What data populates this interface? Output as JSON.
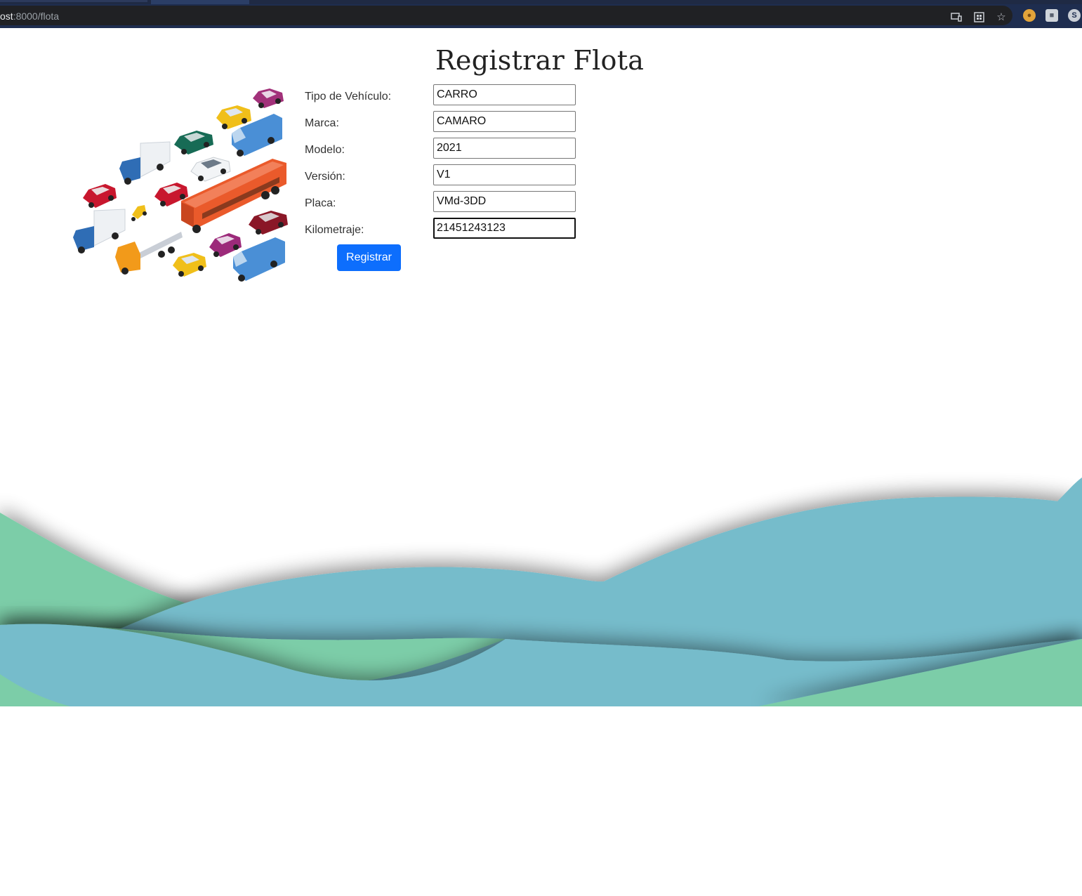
{
  "browser": {
    "url_host": "ost",
    "url_path": ":8000/flota",
    "icons": [
      "cast-icon",
      "apps-icon",
      "star-icon",
      "cookie-extension-icon",
      "cube-extension-icon",
      "s-extension-icon"
    ]
  },
  "page": {
    "title": "Registrar Flota",
    "illustration": "fleet-vehicles-illustration",
    "form": {
      "fields": [
        {
          "label": "Tipo de Vehículo:",
          "value": "CARRO"
        },
        {
          "label": "Marca:",
          "value": "CAMARO"
        },
        {
          "label": "Modelo:",
          "value": "2021"
        },
        {
          "label": "Versión:",
          "value": "V1"
        },
        {
          "label": "Placa:",
          "value": "VMd-3DD"
        },
        {
          "label": "Kilometraje:",
          "value": "21451243123"
        }
      ],
      "submit_label": "Registrar",
      "submit_color": "#0d6efd"
    }
  },
  "colors": {
    "wave_green": "#7ccda8",
    "wave_blue": "#76bccb"
  }
}
